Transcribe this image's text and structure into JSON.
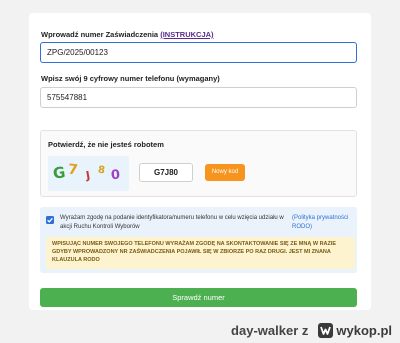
{
  "form": {
    "certificate_label": "Wprowadź numer Zaświadczenia",
    "certificate_link": "(INSTRUKCJA)",
    "certificate_value": "ZPG/2025/00123",
    "phone_label": "Wpisz swój 9 cyfrowy numer telefonu (wymagany)",
    "phone_value": "575547881",
    "captcha": {
      "title": "Potwierdź, że nie jesteś robotem",
      "image_chars": [
        "G",
        "7",
        "J",
        "8",
        "0"
      ],
      "input_value": "G7J80",
      "refresh_label": "Nowy kod"
    },
    "consent": {
      "checked": true,
      "text": "Wyrażam zgodę na podanie identyfikatora/numeru telefonu w celu wzięcia udziału w akcji Ruchu Kontroli Wyborów",
      "link": "(Polityka prywatności RODO)"
    },
    "warning": "WPISUJĄC NUMER SWOJEGO TELEFONU WYRAŻAM ZGODĘ NA SKONTAKTOWANIE SIĘ ZE MNĄ W RAZIE GDYBY WPROWADZONY NR ZAŚWIADCZENIA POJAWIŁ SIĘ W ZBIORZE PO RAZ DRUGI. JEST MI ZNANA KLAUZULA RODO",
    "submit_label": "Sprawdź numer"
  },
  "watermark": {
    "user": "day-walker",
    "z": "z",
    "site": "wykop.pl"
  },
  "colors": {
    "accent_blue": "#2f6fd6",
    "submit_green": "#4caf50",
    "refresh_orange": "#f7941d",
    "warning_bg": "#fdf3cf",
    "consent_bg": "#eaf3fb"
  }
}
